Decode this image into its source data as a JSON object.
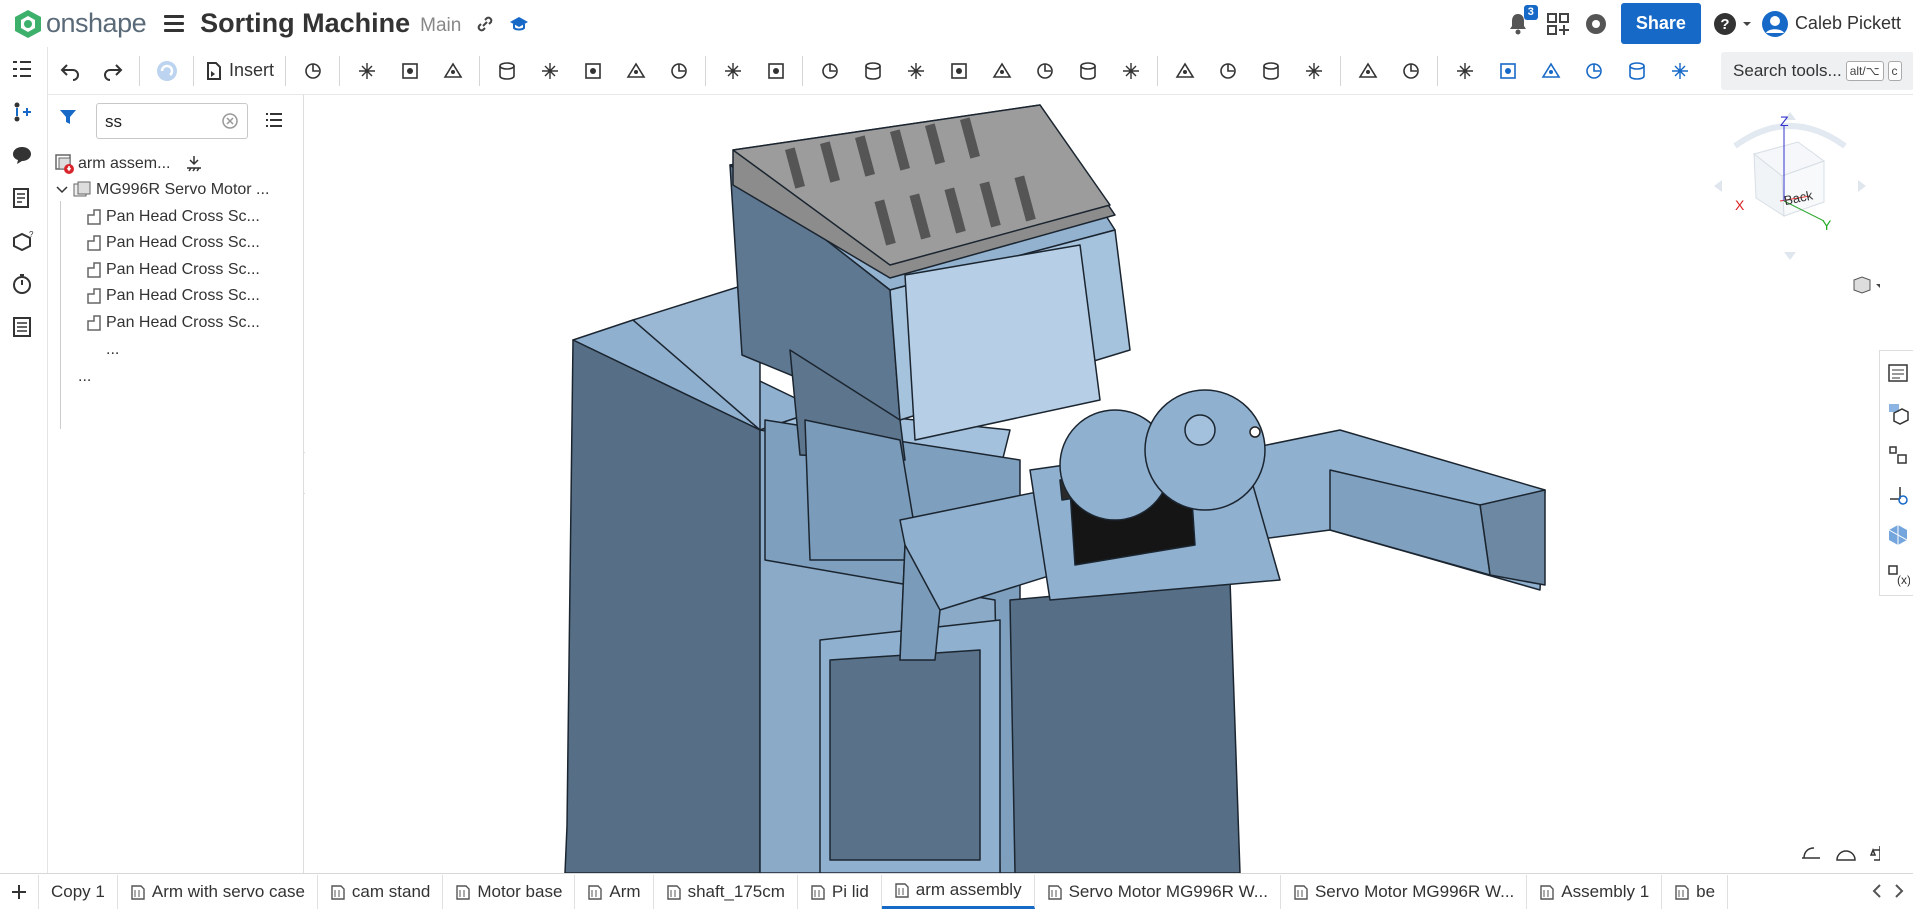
{
  "app": {
    "name": "onshape",
    "doc_title": "Sorting Machine",
    "branch": "Main"
  },
  "header": {
    "notifications_count": "3",
    "share_label": "Share",
    "user_name": "Caleb Pickett"
  },
  "toolbar": {
    "insert_label": "Insert",
    "search_label": "Search tools...",
    "search_kbd1": "alt/⌥",
    "search_kbd2": "c"
  },
  "panel": {
    "filter_value": "ss",
    "tree": {
      "root": "arm assem...",
      "sub": "MG996R Servo Motor ...",
      "items": [
        "Pan Head Cross Sc...",
        "Pan Head Cross Sc...",
        "Pan Head Cross Sc...",
        "Pan Head Cross Sc...",
        "Pan Head Cross Sc..."
      ],
      "more_inner": "...",
      "more_outer": "..."
    }
  },
  "view_cube": {
    "face": "Back",
    "axis_x": "X",
    "axis_y": "Y",
    "axis_z": "Z"
  },
  "tabs": [
    {
      "label": "Copy 1",
      "active": false
    },
    {
      "label": "Arm with servo case",
      "active": false
    },
    {
      "label": "cam stand",
      "active": false
    },
    {
      "label": "Motor base",
      "active": false
    },
    {
      "label": "Arm",
      "active": false
    },
    {
      "label": "shaft_175cm",
      "active": false
    },
    {
      "label": "Pi lid",
      "active": false
    },
    {
      "label": "arm assembly",
      "active": true
    },
    {
      "label": "Servo Motor MG996R W...",
      "active": false
    },
    {
      "label": "Servo Motor MG996R W...",
      "active": false
    },
    {
      "label": "Assembly 1",
      "active": false
    },
    {
      "label": "be",
      "active": false
    }
  ],
  "colors": {
    "brand": "#1769c7",
    "part_blue": "#8fb0cf",
    "part_dark": "#546e85"
  }
}
